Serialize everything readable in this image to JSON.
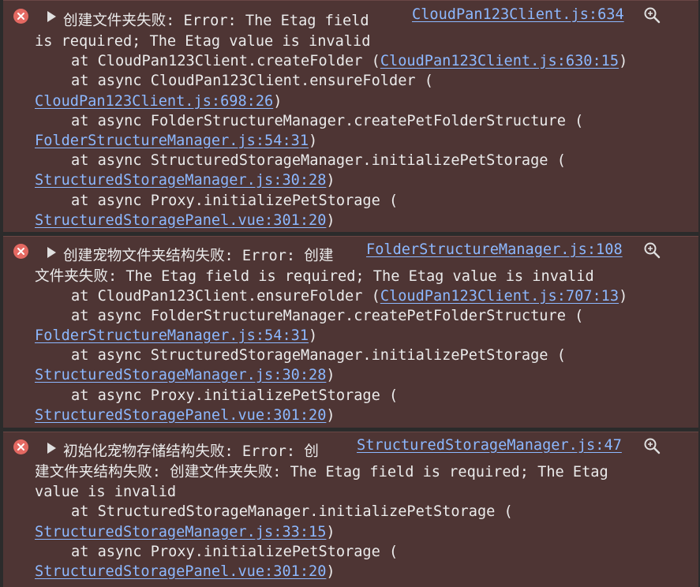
{
  "colors": {
    "background": "#4e3534",
    "text": "#ebebeb",
    "link": "#8cb8ff",
    "error_icon": "#e46962"
  },
  "entries": [
    {
      "source_link": "CloudPan123Client.js:634",
      "message_line1": "创建文件夹失败: Error: The Etag field",
      "message_line2": "is required; The Etag value is invalid",
      "stack": [
        {
          "text": "at CloudPan123Client.createFolder (",
          "link": "CloudPan123Client.js:630:15",
          "suffix": ")"
        },
        {
          "text": "at async CloudPan123Client.ensureFolder (",
          "link": "CloudPan123Client.js:698:26",
          "suffix": ")"
        },
        {
          "text": "at async FolderStructureManager.createPetFolderStructure (",
          "link": "FolderStructureManager.js:54:31",
          "suffix": ")"
        },
        {
          "text": "at async StructuredStorageManager.initializePetStorage (",
          "link": "StructuredStorageManager.js:30:28",
          "suffix": ")"
        },
        {
          "text": "at async Proxy.initializePetStorage (",
          "link": "StructuredStoragePanel.vue:301:20",
          "suffix": ")"
        }
      ]
    },
    {
      "source_link": "FolderStructureManager.js:108",
      "message_line1": "创建宠物文件夹结构失败: Error: 创建",
      "message_line2": "文件夹失败: The Etag field is required; The Etag value is invalid",
      "stack": [
        {
          "text": "at CloudPan123Client.ensureFolder (",
          "link": "CloudPan123Client.js:707:13",
          "suffix": ")"
        },
        {
          "text": "at async FolderStructureManager.createPetFolderStructure (",
          "link": "FolderStructureManager.js:54:31",
          "suffix": ")"
        },
        {
          "text": "at async StructuredStorageManager.initializePetStorage (",
          "link": "StructuredStorageManager.js:30:28",
          "suffix": ")"
        },
        {
          "text": "at async Proxy.initializePetStorage (",
          "link": "StructuredStoragePanel.vue:301:20",
          "suffix": ")"
        }
      ]
    },
    {
      "source_link": "StructuredStorageManager.js:47",
      "message_line1": "初始化宠物存储结构失败: Error: 创",
      "message_line2": "建文件夹结构失败: 创建文件夹失败: The Etag field is required; The Etag",
      "message_line3": "value is invalid",
      "stack": [
        {
          "text": "at StructuredStorageManager.initializePetStorage (",
          "link": "StructuredStorageManager.js:33:15",
          "suffix": ")"
        },
        {
          "text": "at async Proxy.initializePetStorage (",
          "link": "StructuredStoragePanel.vue:301:20",
          "suffix": ")"
        }
      ]
    }
  ]
}
